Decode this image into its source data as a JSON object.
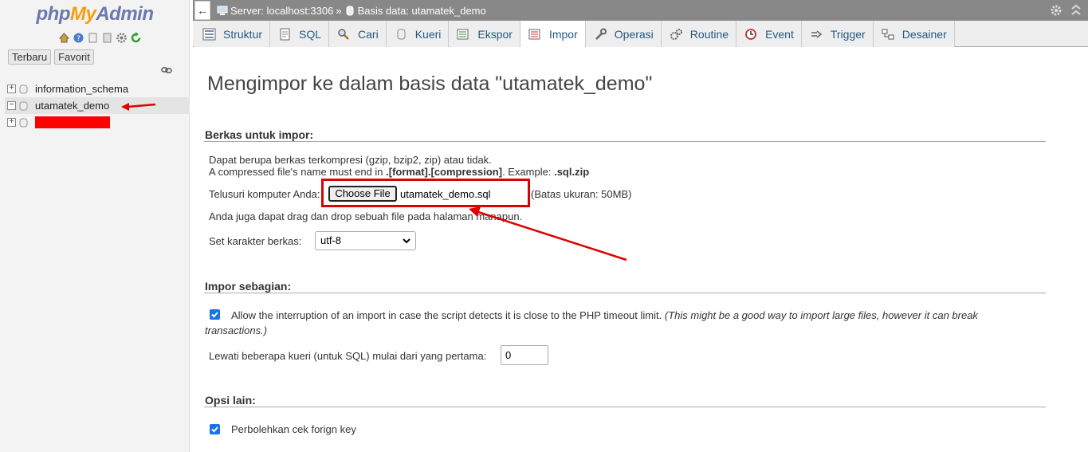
{
  "app": {
    "logo_php": "php",
    "logo_my": "My",
    "logo_admin": "Admin"
  },
  "sidebar": {
    "nav_buttons": [
      "Terbaru",
      "Favorit"
    ],
    "databases": [
      {
        "name": "information_schema",
        "expander": "+"
      },
      {
        "name": "utamatek_demo",
        "expander": "−"
      },
      {
        "name": "",
        "expander": "+"
      }
    ]
  },
  "topbar": {
    "back": "←",
    "server": "Server: localhost:3306",
    "separator": "»",
    "database": "Basis data: utamatek_demo"
  },
  "tabs": [
    "Struktur",
    "SQL",
    "Cari",
    "Kueri",
    "Ekspor",
    "Impor",
    "Operasi",
    "Routine",
    "Event",
    "Trigger",
    "Desainer"
  ],
  "main": {
    "title": "Mengimpor ke dalam basis data \"utamatek_demo\"",
    "file_section": {
      "heading": "Berkas untuk impor:",
      "line1": "Dapat berupa berkas terkompresi (gzip, bzip2, zip) atau tidak.",
      "line2_a": "A compressed file's name must end in ",
      "line2_b": ".[format].[compression]",
      "line2_c": ". Example: ",
      "line2_d": ".sql.zip",
      "browse_label": "Telusuri komputer Anda:",
      "choose_button": "Choose File",
      "file_name": "utamatek_demo.sql",
      "size_limit": "(Batas ukuran: 50MB)",
      "drag_text": "Anda juga dapat drag dan drop sebuah file pada halaman manapun.",
      "charset_label": "Set karakter berkas:",
      "charset_value": "utf-8"
    },
    "partial_section": {
      "heading": "Impor sebagian:",
      "allow_text": "Allow the interruption of an import in case the script detects it is close to the PHP timeout limit.",
      "allow_note_1": "(This might be a good way to import large files, however it can break",
      "allow_note_2": "transactions.)",
      "skip_label": "Lewati beberapa kueri (untuk SQL) mulai dari yang pertama:",
      "skip_value": "0"
    },
    "other_section": {
      "heading": "Opsi lain:",
      "fk_label": "Perbolehkan cek forign key"
    }
  },
  "colors": {
    "accent": "#235a81",
    "annotation_red": "#dd0000",
    "checkbox_blue": "#1a73e8"
  }
}
